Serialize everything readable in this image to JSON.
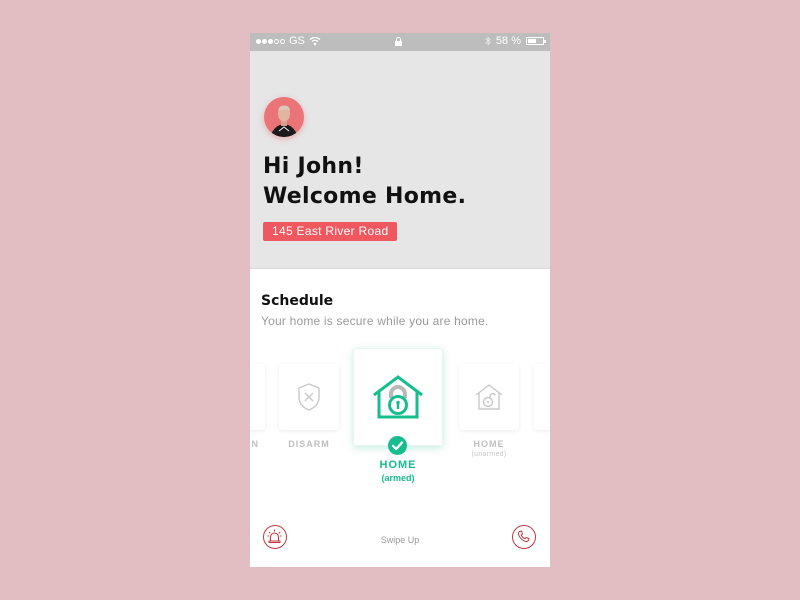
{
  "status_bar": {
    "signal_filled": 3,
    "signal_total": 5,
    "carrier": "GS",
    "battery_percent_label": "58 %",
    "battery_level": 0.58,
    "icons": [
      "signal-dots-icon",
      "wifi-icon",
      "lock-icon",
      "bluetooth-icon",
      "battery-icon"
    ]
  },
  "header": {
    "greeting_line1": "Hi John!",
    "greeting_line2": "Welcome Home.",
    "address": "145 East River Road",
    "avatar": "user-avatar"
  },
  "schedule": {
    "title": "Schedule",
    "subtitle": "Your home is secure while you are home."
  },
  "modes": {
    "partial_left_label": "ION",
    "disarm": {
      "label": "DISARM",
      "icon": "shield-x-icon"
    },
    "home_armed": {
      "label": "HOME",
      "sublabel": "(armed)",
      "icon": "house-lock-icon",
      "selected": true
    },
    "home_unarmed": {
      "label": "HOME",
      "sublabel": "(unarmed)",
      "icon": "house-unlocked-icon"
    }
  },
  "bottom_bar": {
    "swipe_label": "Swipe Up",
    "alarm_icon": "siren-icon",
    "phone_icon": "phone-icon"
  },
  "colors": {
    "accent_green": "#16bd8e",
    "alert_red": "#f0585f",
    "icon_red": "#c0393e",
    "background_pink": "#e2bec2"
  }
}
